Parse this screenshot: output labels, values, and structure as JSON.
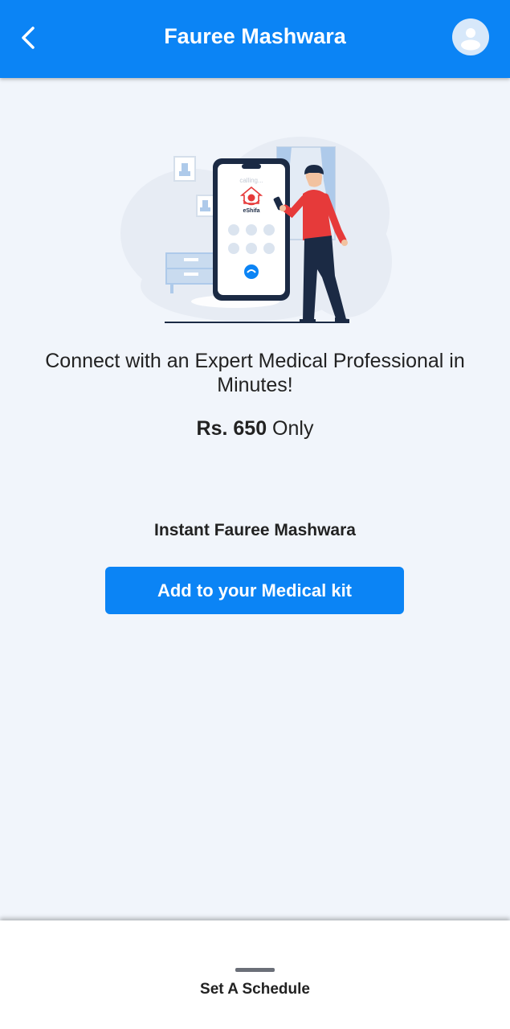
{
  "header": {
    "title": "Fauree Mashwara",
    "back_icon": "chevron-left-icon",
    "avatar_icon": "user-icon",
    "color": "#0b84f5"
  },
  "illustration": {
    "phone_screen_text": "calling...",
    "brand_label": "eShifa"
  },
  "main": {
    "tagline": "Connect with an Expert Medical Professional in Minutes!",
    "price_amount": "Rs. 650",
    "price_suffix": "Only",
    "instant_title": "Instant Fauree Mashwara",
    "add_button_label": "Add to your Medical kit"
  },
  "bottom_sheet": {
    "label": "Set A Schedule"
  },
  "colors": {
    "accent": "#0b84f5",
    "background": "#f1f5fb",
    "figure_shirt": "#e63a3a"
  }
}
